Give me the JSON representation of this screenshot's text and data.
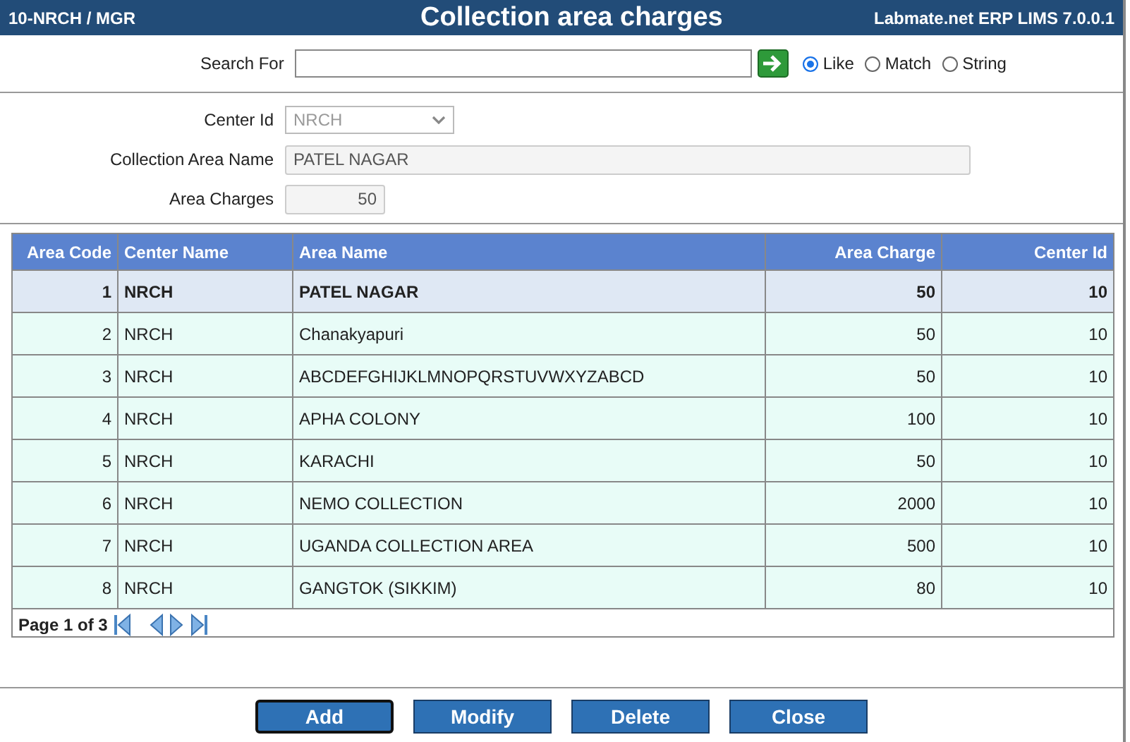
{
  "header": {
    "user": "10-NRCH / MGR",
    "title": "Collection area charges",
    "product": "Labmate.net ERP LIMS 7.0.0.1"
  },
  "search": {
    "label": "Search For",
    "modes": [
      {
        "label": "Like",
        "selected": true
      },
      {
        "label": "Match",
        "selected": false
      },
      {
        "label": "String",
        "selected": false
      }
    ]
  },
  "form": {
    "center_id": {
      "label": "Center Id",
      "value": "NRCH"
    },
    "area_name": {
      "label": "Collection Area Name",
      "value": "PATEL NAGAR"
    },
    "area_charges": {
      "label": "Area Charges",
      "value": "50"
    }
  },
  "table": {
    "columns": [
      "Area Code",
      "Center Name",
      "Area Name",
      "Area Charge",
      "Center Id"
    ],
    "rows": [
      {
        "cells": [
          "1",
          "NRCH",
          "PATEL NAGAR",
          "50",
          "10"
        ],
        "selected": true
      },
      {
        "cells": [
          "2",
          "NRCH",
          "Chanakyapuri",
          "50",
          "10"
        ],
        "selected": false
      },
      {
        "cells": [
          "3",
          "NRCH",
          "ABCDEFGHIJKLMNOPQRSTUVWXYZABCD",
          "50",
          "10"
        ],
        "selected": false
      },
      {
        "cells": [
          "4",
          "NRCH",
          "APHA COLONY",
          "100",
          "10"
        ],
        "selected": false
      },
      {
        "cells": [
          "5",
          "NRCH",
          "KARACHI",
          "50",
          "10"
        ],
        "selected": false
      },
      {
        "cells": [
          "6",
          "NRCH",
          "NEMO COLLECTION",
          "2000",
          "10"
        ],
        "selected": false
      },
      {
        "cells": [
          "7",
          "NRCH",
          "UGANDA COLLECTION AREA",
          "500",
          "10"
        ],
        "selected": false
      },
      {
        "cells": [
          "8",
          "NRCH",
          "GANGTOK (SIKKIM)",
          "80",
          "10"
        ],
        "selected": false
      }
    ],
    "pager": "Page 1 of 3"
  },
  "buttons": [
    {
      "label": "Add",
      "focused": true
    },
    {
      "label": "Modify",
      "focused": false
    },
    {
      "label": "Delete",
      "focused": false
    },
    {
      "label": "Close",
      "focused": false
    }
  ]
}
